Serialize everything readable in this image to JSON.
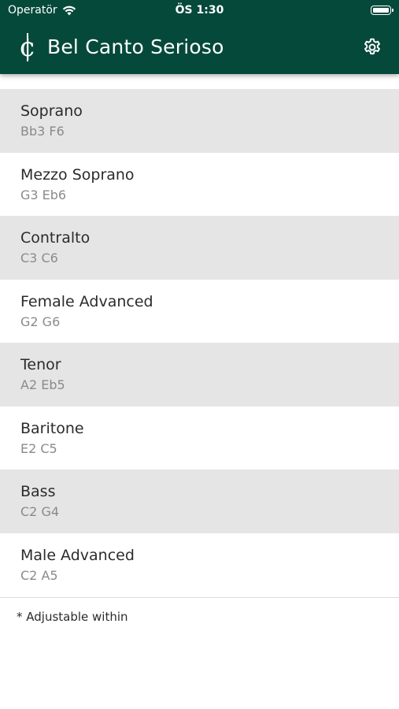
{
  "status": {
    "carrier": "Operatör",
    "time": "ÖS 1:30"
  },
  "appbar": {
    "title": "Bel Canto Serioso",
    "logo_glyph": "¢",
    "settings_icon": "gear-icon"
  },
  "voices": [
    {
      "name": "Soprano",
      "range": "Bb3 F6"
    },
    {
      "name": "Mezzo Soprano",
      "range": "G3 Eb6"
    },
    {
      "name": "Contralto",
      "range": "C3 C6"
    },
    {
      "name": "Female Advanced",
      "range": "G2 G6"
    },
    {
      "name": "Tenor",
      "range": "A2 Eb5"
    },
    {
      "name": "Baritone",
      "range": "E2 C5"
    },
    {
      "name": "Bass",
      "range": "C2 G4"
    },
    {
      "name": "Male Advanced",
      "range": "C2 A5"
    }
  ],
  "footnote": "* Adjustable within",
  "colors": {
    "header": "#05493a",
    "shaded_row": "#e5e5e5",
    "range_text": "#8a8a8a"
  }
}
